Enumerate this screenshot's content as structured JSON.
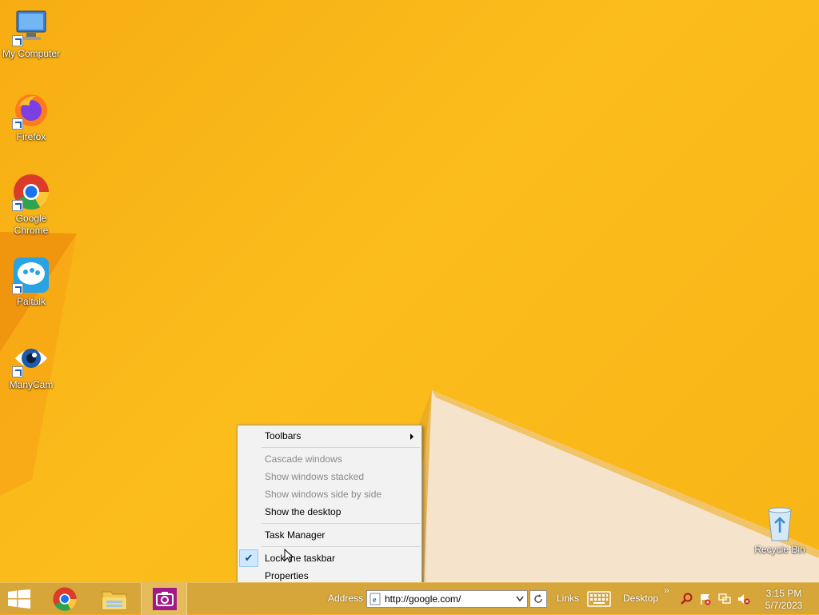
{
  "desktop_icons": [
    {
      "label": "My Computer",
      "icon": "computer-icon"
    },
    {
      "label": "Firefox",
      "icon": "firefox-icon"
    },
    {
      "label": "Google Chrome",
      "icon": "chrome-icon"
    },
    {
      "label": "Paltalk",
      "icon": "paltalk-icon"
    },
    {
      "label": "ManyCam",
      "icon": "manycam-icon"
    },
    {
      "label": "Recycle Bin",
      "icon": "recycle-bin-icon"
    }
  ],
  "context_menu": {
    "toolbars": "Toolbars",
    "cascade": "Cascade windows",
    "stacked": "Show windows stacked",
    "side_by_side": "Show windows side by side",
    "show_desktop": "Show the desktop",
    "task_manager": "Task Manager",
    "lock_taskbar": "Lock the taskbar",
    "properties": "Properties",
    "check_glyph": "✔"
  },
  "taskbar": {
    "address_label": "Address",
    "address_value": "http://google.com/",
    "links_label": "Links",
    "desktop_label": "Desktop",
    "overflow_glyph": "»",
    "time": "3:15 PM",
    "date": "5/7/2023"
  },
  "colors": {
    "wallpaper": "#f8b416",
    "taskbar": "#d6a63b",
    "menu_bg": "#f2f2f2"
  }
}
